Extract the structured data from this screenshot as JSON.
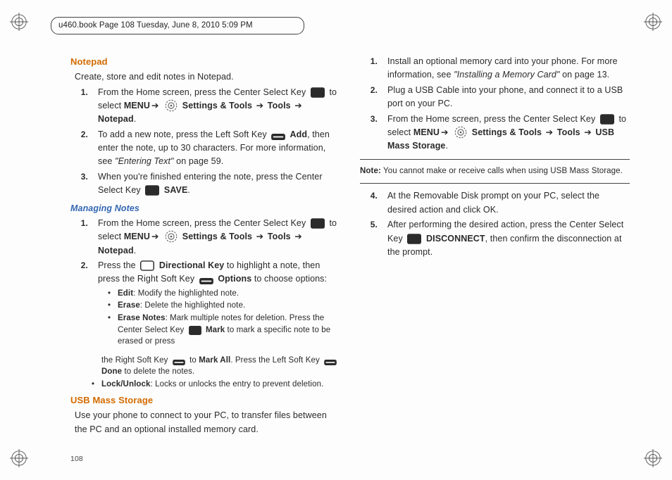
{
  "header_line": "u460.book  Page 108  Tuesday, June 8, 2010  5:09 PM",
  "page_number": "108",
  "arrow": "➔",
  "h_notepad": "Notepad",
  "notepad_intro": "Create, store and edit notes in Notepad.",
  "np1_a": "From the Home screen, press the Center Select Key ",
  "np1_b": " to select ",
  "np1_menu": "MENU",
  "np1_settings": " Settings & Tools ",
  "np1_tools": " Tools ",
  "np1_last": "Notepad",
  "np1_dot": ".",
  "np2_a": "To add a new note, press the Left Soft Key ",
  "np2_add": " Add",
  "np2_b": ", then enter the note, up to 30 characters. For more information, see ",
  "np2_ref": "\"Entering Text\"",
  "np2_c": " on page 59.",
  "np3_a": "When you're finished entering the note, press the Center Select Key ",
  "np3_save": " SAVE",
  "np3_dot": ".",
  "h_managing": "Managing Notes",
  "mn1_a": "From the Home screen, press the Center Select Key ",
  "mn1_b": " to select ",
  "mn2_a": "Press the ",
  "mn2_dir": " Directional Key",
  "mn2_b": " to highlight a note, then press the Right Soft Key ",
  "mn2_opt": " Options",
  "mn2_c": " to choose options:",
  "opt_edit_t": "Edit",
  "opt_edit_b": ": Modify the highlighted note.",
  "opt_erase_t": "Erase",
  "opt_erase_b": ": Delete the highlighted note.",
  "opt_en_t": "Erase Notes",
  "opt_en_b1": ": Mark multiple notes for deletion. Press the Center Select Key ",
  "opt_en_mark": " Mark",
  "opt_en_b2": " to mark a specific note to be erased or press",
  "opt_en_col2a": "the Right Soft Key ",
  "opt_en_markall": " to ",
  "opt_en_markall_b": "Mark All",
  "opt_en_col2b": ". Press the Left Soft Key ",
  "opt_en_done": "Done",
  "opt_en_col2c": " to delete the notes.",
  "opt_lock_t": "Lock/Unlock",
  "opt_lock_b": ": Locks or unlocks the entry to prevent deletion.",
  "h_usb": "USB Mass Storage",
  "usb_intro": "Use your phone to connect to your PC, to transfer files between the PC and an optional installed memory card.",
  "u1_a": "Install an optional memory card into your phone. For more information, see ",
  "u1_ref": "\"Installing a Memory Card\"",
  "u1_b": " on page 13.",
  "u2": "Plug a USB Cable into your phone, and connect it to a USB port on your PC.",
  "u3_a": "From the Home screen, press the Center Select Key ",
  "u3_b": " to select ",
  "u3_last": " USB Mass Storage",
  "u3_dot": ".",
  "note_label": "Note:",
  "note_body": " You cannot make or receive calls when using USB Mass Storage.",
  "u4": "At the Removable Disk prompt on your PC, select the desired action and click OK.",
  "u5_a": "After performing the desired action, press the Center Select Key ",
  "u5_disc": " DISCONNECT",
  "u5_b": ", then confirm the disconnection at the prompt.",
  "n1": "1.",
  "n2": "2.",
  "n3": "3.",
  "n4": "4.",
  "n5": "5."
}
